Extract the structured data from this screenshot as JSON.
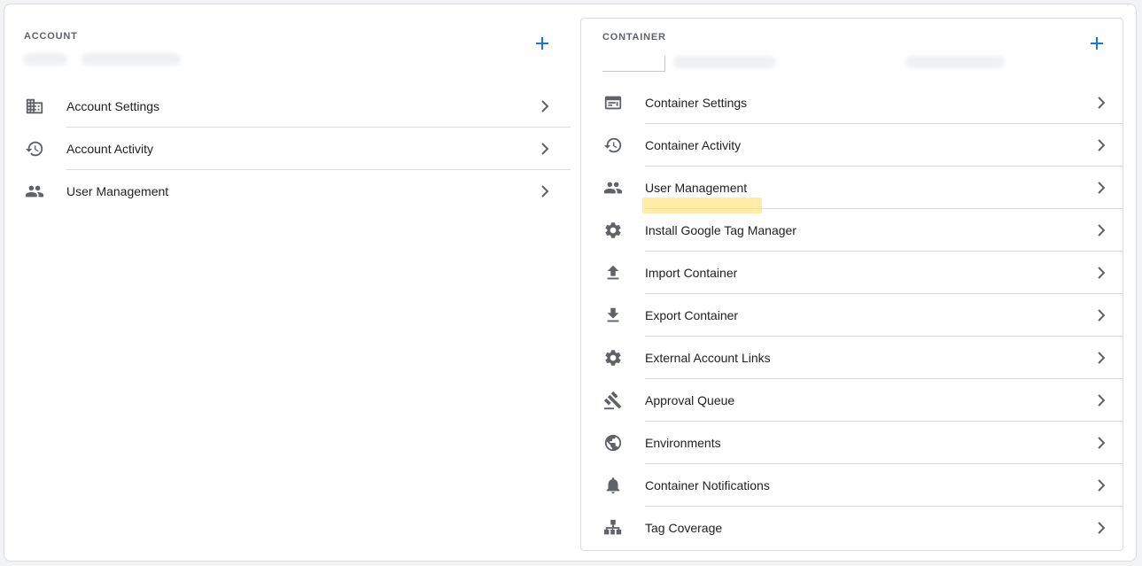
{
  "account": {
    "title": "ACCOUNT",
    "items": [
      {
        "label": "Account Settings",
        "icon": "building-icon"
      },
      {
        "label": "Account Activity",
        "icon": "history-icon"
      },
      {
        "label": "User Management",
        "icon": "people-icon"
      }
    ]
  },
  "container": {
    "title": "CONTAINER",
    "items": [
      {
        "label": "Container Settings",
        "icon": "web-window-icon"
      },
      {
        "label": "Container Activity",
        "icon": "history-icon"
      },
      {
        "label": "User Management",
        "icon": "people-icon"
      },
      {
        "label": "Install Google Tag Manager",
        "icon": "gear-icon"
      },
      {
        "label": "Import Container",
        "icon": "upload-icon"
      },
      {
        "label": "Export Container",
        "icon": "download-icon"
      },
      {
        "label": "External Account Links",
        "icon": "gear-icon"
      },
      {
        "label": "Approval Queue",
        "icon": "gavel-icon"
      },
      {
        "label": "Environments",
        "icon": "globe-icon"
      },
      {
        "label": "Container Notifications",
        "icon": "bell-icon"
      },
      {
        "label": "Tag Coverage",
        "icon": "hierarchy-icon"
      }
    ]
  },
  "colors": {
    "accent": "#1a73e8",
    "icon": "#5f6368",
    "highlight": "#fde68a"
  }
}
